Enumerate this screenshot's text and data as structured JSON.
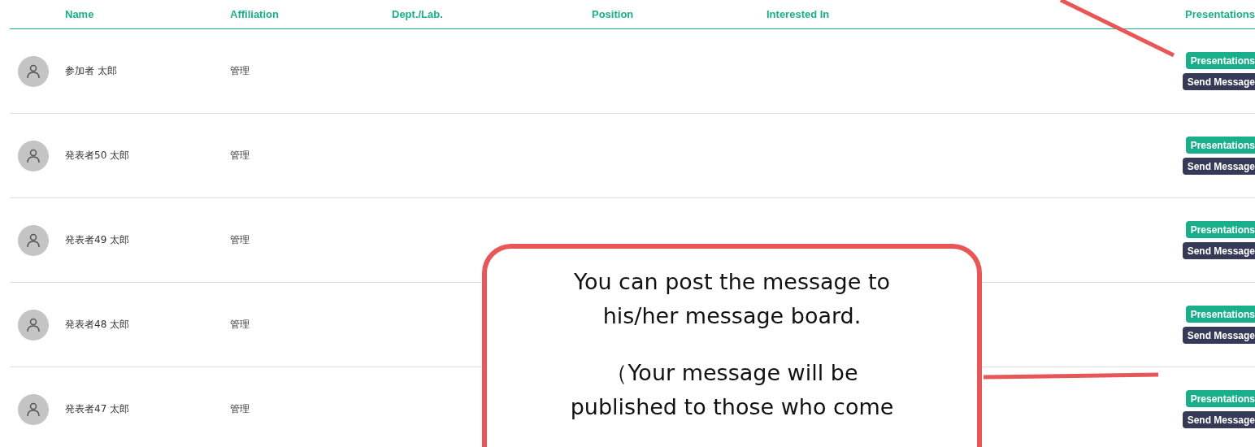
{
  "table": {
    "columns": [
      {
        "label": "Name"
      },
      {
        "label": "Affiliation"
      },
      {
        "label": "Dept./Lab."
      },
      {
        "label": "Position"
      },
      {
        "label": "Interested In"
      },
      {
        "label": "Presentations"
      }
    ],
    "rows": [
      {
        "name": "参加者 太郎",
        "affiliation": "管理",
        "buttons": [
          {
            "kind": "presentations",
            "label": "Presentations"
          },
          {
            "kind": "message",
            "label": "Send Message"
          }
        ]
      },
      {
        "name": "発表者50 太郎",
        "affiliation": "管理",
        "buttons": [
          {
            "kind": "presentations",
            "label": "Presentations"
          },
          {
            "kind": "message",
            "label": "Send Message"
          }
        ]
      },
      {
        "name": "発表者49 太郎",
        "affiliation": "管理",
        "buttons": [
          {
            "kind": "presentations",
            "label": "Presentations"
          },
          {
            "kind": "message",
            "label": "Send Message"
          }
        ]
      },
      {
        "name": "発表者48 太郎",
        "affiliation": "管理",
        "buttons": [
          {
            "kind": "presentations",
            "label": "Presentations"
          },
          {
            "kind": "message",
            "label": "Send Message"
          }
        ]
      },
      {
        "name": "発表者47 太郎",
        "affiliation": "管理",
        "buttons": [
          {
            "kind": "presentations",
            "label": "Presentations"
          },
          {
            "kind": "message",
            "label": "Send Message"
          }
        ]
      }
    ]
  },
  "callout": {
    "paragraphs": [
      [
        "You can post the message to",
        "his/her message board."
      ],
      [
        "（Your message will be",
        "published to those who come"
      ]
    ]
  }
}
